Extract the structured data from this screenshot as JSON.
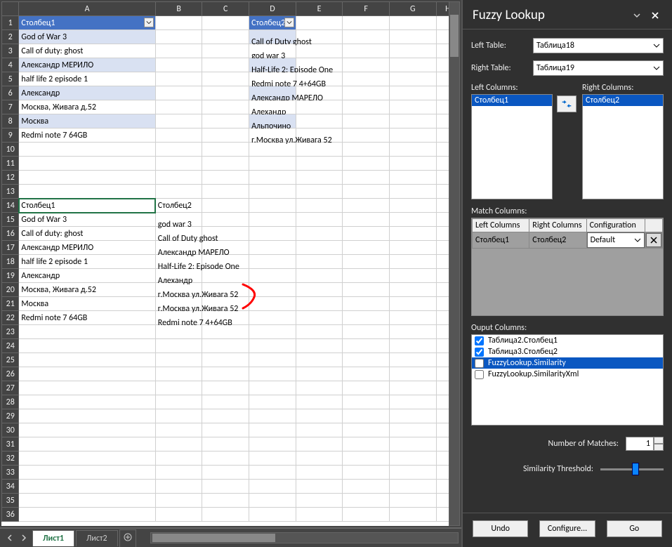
{
  "spreadsheet": {
    "columns": [
      "A",
      "B",
      "C",
      "D",
      "E",
      "F",
      "G",
      "H"
    ],
    "table1": {
      "header": "Столбец1",
      "rows": [
        "God of War 3",
        "Call of duty: ghost",
        "Александр МЕРИЛО",
        "half life 2 episode 1",
        "Александр",
        "Москва, Живага д.52",
        "Москва",
        "Redmi note 7 64GB"
      ]
    },
    "table2": {
      "header": "Столбец2",
      "rows": [
        "Call of Duty ghost",
        "god war 3",
        "Half-Life 2: Episode One",
        "Redmi note 7 4+64GB",
        "Александр МАРЕЛО",
        "Алехандр",
        "Альпочино",
        "г.Москва ул.Живага 52"
      ]
    },
    "result": {
      "headers": [
        "Столбец1",
        "Столбец2"
      ],
      "rows": [
        [
          "God of War 3",
          "god war 3"
        ],
        [
          "Call of duty: ghost",
          "Call of Duty ghost"
        ],
        [
          "Александр МЕРИЛО",
          "Александр МАРЕЛО"
        ],
        [
          "half life 2 episode 1",
          "Half-Life 2: Episode One"
        ],
        [
          "Александр",
          "Алехандр"
        ],
        [
          "Москва, Живага д.52",
          "г.Москва ул.Живага 52"
        ],
        [
          "Москва",
          "г.Москва ул.Живага 52"
        ],
        [
          "Redmi note 7 64GB",
          "Redmi note 7 4+64GB"
        ]
      ]
    },
    "sheets": {
      "active": "Лист1",
      "other": "Лист2"
    }
  },
  "pane": {
    "title": "Fuzzy Lookup",
    "leftTableLbl": "Left Table:",
    "rightTableLbl": "Right Table:",
    "leftTableVal": "Таблица18",
    "rightTableVal": "Таблица19",
    "leftColsLbl": "Left Columns:",
    "rightColsLbl": "Right Columns:",
    "leftColItem": "Столбец1",
    "rightColItem": "Столбец2",
    "matchColsLbl": "Match Columns:",
    "matchHeaders": {
      "left": "Left Columns",
      "right": "Right Columns",
      "cfg": "Configuration"
    },
    "matchRow": {
      "left": "Столбец1",
      "right": "Столбец2",
      "cfg": "Default"
    },
    "outputLbl": "Ouput Columns:",
    "outputs": [
      {
        "label": "Таблица2.Столбец1",
        "checked": true,
        "sel": false
      },
      {
        "label": "Таблица3.Столбец2",
        "checked": true,
        "sel": false
      },
      {
        "label": "FuzzyLookup.Similarity",
        "checked": false,
        "sel": true
      },
      {
        "label": "FuzzyLookup.SimilarityXml",
        "checked": false,
        "sel": false
      }
    ],
    "numMatchesLbl": "Number of Matches:",
    "numMatchesVal": "1",
    "simThreshLbl": "Similarity Threshold:",
    "footer": {
      "undo": "Undo",
      "config": "Configure...",
      "go": "Go"
    }
  }
}
